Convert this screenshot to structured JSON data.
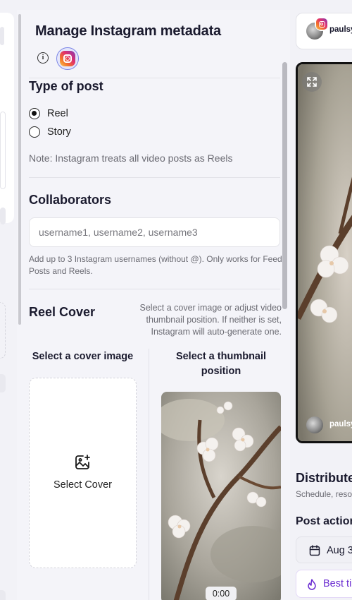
{
  "modal": {
    "title": "Manage Instagram metadata",
    "info_icon": "info-icon",
    "platform_icon": "instagram-icon"
  },
  "post_type": {
    "heading": "Type of post",
    "options": [
      {
        "label": "Reel",
        "selected": true
      },
      {
        "label": "Story",
        "selected": false
      }
    ],
    "note": "Note: Instagram treats all video posts as Reels"
  },
  "collaborators": {
    "heading": "Collaborators",
    "placeholder": "username1, username2, username3",
    "value": "",
    "help": "Add up to 3 Instagram usernames (without @). Only works for Feed Posts and Reels."
  },
  "reel_cover": {
    "heading": "Reel Cover",
    "hint": "Select a cover image or adjust video thumbnail position. If neither is set, Instagram will auto-generate one.",
    "cover_column_heading": "Select a cover image",
    "cover_button_label": "Select Cover",
    "cover_icon": "image-plus-icon",
    "thumbnail_column_heading": "Select a thumbnail position",
    "thumbnail_time": "0:00"
  },
  "preview": {
    "account_name": "paulsy",
    "expand_icon": "expand-icon"
  },
  "distribution": {
    "title": "Distribute",
    "subtitle": "Schedule, reso",
    "post_actions_heading": "Post action",
    "date_label": "Aug 3",
    "date_icon": "calendar-icon",
    "best_time_label": "Best ti",
    "best_time_icon": "flame-icon"
  },
  "colors": {
    "accent_purple": "#6a2bd1",
    "badge_border": "#7c86e6",
    "panel_bg": "#f4f4f9"
  }
}
